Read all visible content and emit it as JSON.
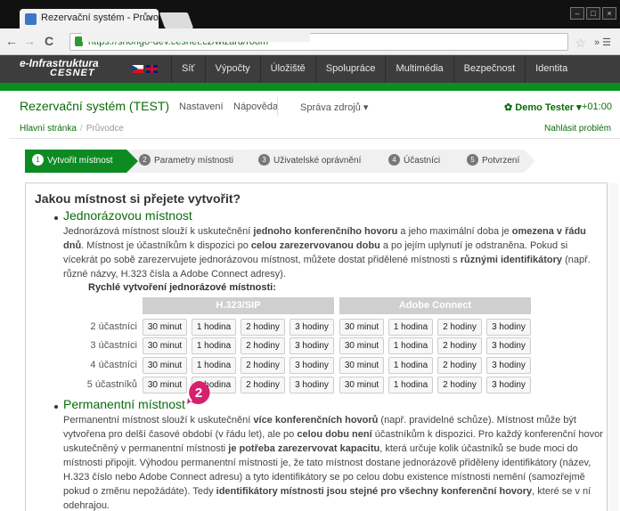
{
  "browser": {
    "tab_title": "Rezervační systém - Průvo",
    "tab_close": "×",
    "url": "https://shongo-dev.cesnet.cz/wizard/room",
    "back": "←",
    "forward": "→",
    "reload": "C",
    "star": "☆",
    "more": "» ☰",
    "win_min": "–",
    "win_max": "□",
    "win_close": "×"
  },
  "infra": {
    "logo_line1": "e-Infrastruktura",
    "logo_line2": "CESNET",
    "menu": [
      "Síť",
      "Výpočty",
      "Úložiště",
      "Spolupráce",
      "Multimédia",
      "Bezpečnost",
      "Identita"
    ]
  },
  "app": {
    "title": "Rezervační systém (TEST)",
    "nav": [
      "Nastavení",
      "Nápověda",
      "Správa zdrojů ▾"
    ],
    "user": "✿ Demo Tester ▾",
    "timezone": "+01:00",
    "breadcrumb": [
      "Hlavní stránka",
      "Průvodce"
    ],
    "breadcrumb_sep": "/",
    "report": "Nahlásit problém"
  },
  "wizard": {
    "steps": [
      {
        "num": "1",
        "label": "Vytvořit místnost"
      },
      {
        "num": "2",
        "label": "Parametry místnosti"
      },
      {
        "num": "3",
        "label": "Uživatelské oprávnění"
      },
      {
        "num": "4",
        "label": "Účastníci"
      },
      {
        "num": "5",
        "label": "Potvrzení"
      }
    ]
  },
  "content": {
    "question": "Jakou místnost si přejete vytvořit?",
    "once_title": "Jednorázovou místnost",
    "once_text": "Jednorázová místnost slouží k uskutečnění <b>jednoho konferenčního hovoru</b> a jeho maximální doba je <b>omezena v řádu dnů</b>. Místnost je účastníkům k dispozici po <b>celou zarezervovanou dobu</b> a po jejím uplynutí je odstraněna. Pokud si vícekrát po sobě zarezervujete jednorázovou místnost, můžete dostat přidělené místnosti s <b>různými identifikátory</b> (např. různé názvy, H.323 čísla a Adobe Connect adresy).",
    "quick_title": "Rychlé vytvoření jednorázové místnosti:",
    "col_h323": "H.323/SIP",
    "col_adobe": "Adobe Connect",
    "row_labels": [
      "2 účastníci",
      "3 účastníci",
      "4 účastníci",
      "5 účastníků"
    ],
    "durations": [
      "30 minut",
      "1 hodina",
      "2 hodiny",
      "3 hodiny"
    ],
    "perm_title": "Permanentní místnost",
    "perm_text": "Permanentní místnost slouží k uskutečnění <b>více konferenčních hovorů</b> (např. pravidelné schůze). Místnost může být vytvořena pro delší časové období (v řádu let), ale po <b>celou dobu není</b> účastníkům k dispozici. Pro každý konferenční hovor uskutečněný v permanentní místnosti <b>je potřeba zarezervovat kapacitu</b>, která určuje kolik účastníků se bude moci do místnosti připojit. Výhodou permanentní místnosti je, že tato místnost dostane jednorázově přiděleny identifikátory (název, H.323 číslo nebo Adobe Connect adresu) a tyto identifikátory se po celou dobu existence místnosti nemění (samozřejmě pokud o změnu nepožádáte). Tedy <b>identifikátory místnosti jsou stejné pro všechny konferenční hovory</b>, které se v ní odehrajou."
  },
  "marker": {
    "label": "2",
    "color": "#d6226e"
  }
}
